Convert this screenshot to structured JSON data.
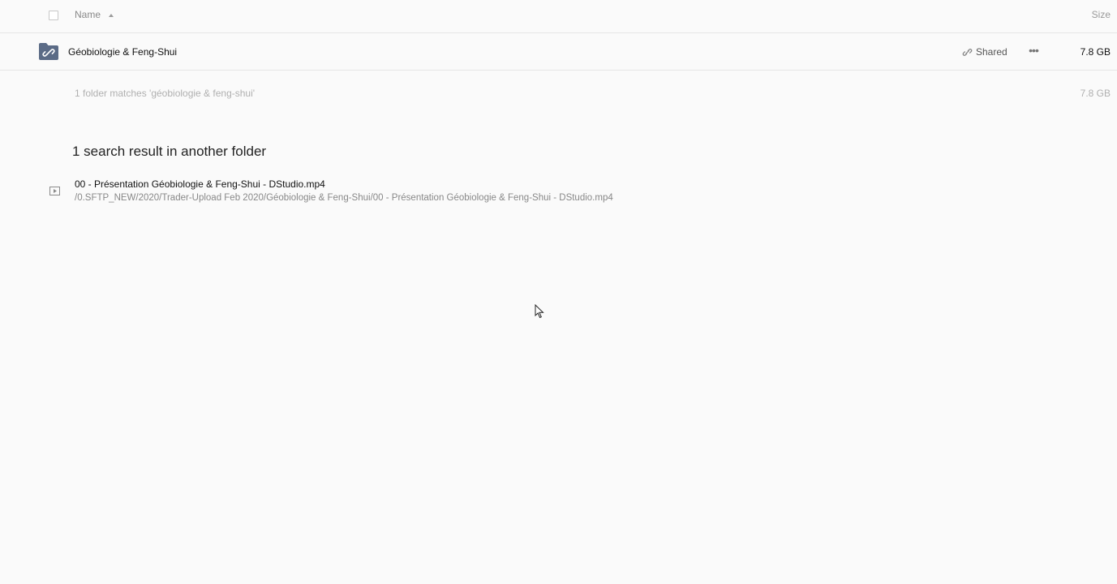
{
  "list_header": {
    "name_label": "Name",
    "size_label": "Size",
    "sort_icon": "sort-ascending-icon",
    "select_all_icon": "checkbox-icon"
  },
  "folder_row": {
    "name": "Géobiologie & Feng-Shui",
    "icon": "shared-folder-icon",
    "shared_label": "Shared",
    "more_label": "•••",
    "size": "7.8 GB"
  },
  "summary": {
    "text": "1 folder matches 'géobiologie & feng-shui'",
    "size": "7.8 GB"
  },
  "other_results": {
    "title": "1 search result in another folder",
    "items": [
      {
        "name": "00 - Présentation Géobiologie & Feng-Shui - DStudio.mp4",
        "path": "/0.SFTP_NEW/2020/Trader-Upload Feb 2020/Géobiologie & Feng-Shui/00 - Présentation Géobiologie & Feng-Shui - DStudio.mp4",
        "icon": "video-file-icon"
      }
    ]
  },
  "colors": {
    "background": "#fafafa",
    "folder_icon": "#5b6b86",
    "divider": "#e6e6e6"
  }
}
